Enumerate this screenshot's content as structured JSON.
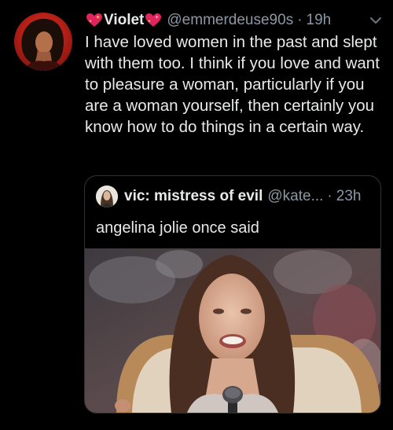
{
  "tweet": {
    "display_name": "Violet",
    "handle": "@emmerdeuse90s",
    "dot": "·",
    "time": "19h",
    "text": "I have loved women in the past and slept with them too. I think if you love and want to pleasure a woman, particularly if you are a woman yourself, then certainly you know how to do things in a certain way.",
    "name_icon": "sparkling-heart-icon",
    "menu_icon": "chevron-down-icon"
  },
  "quote": {
    "display_name": "vic: mistress of evil",
    "handle": "@kate...",
    "dot": "·",
    "time": "23h",
    "text": "angelina jolie once said"
  },
  "colors": {
    "background": "#000000",
    "primary_text": "#e7e9ea",
    "secondary_text": "#8b98a5",
    "border": "#2f3336",
    "heart": "#e0245e"
  }
}
